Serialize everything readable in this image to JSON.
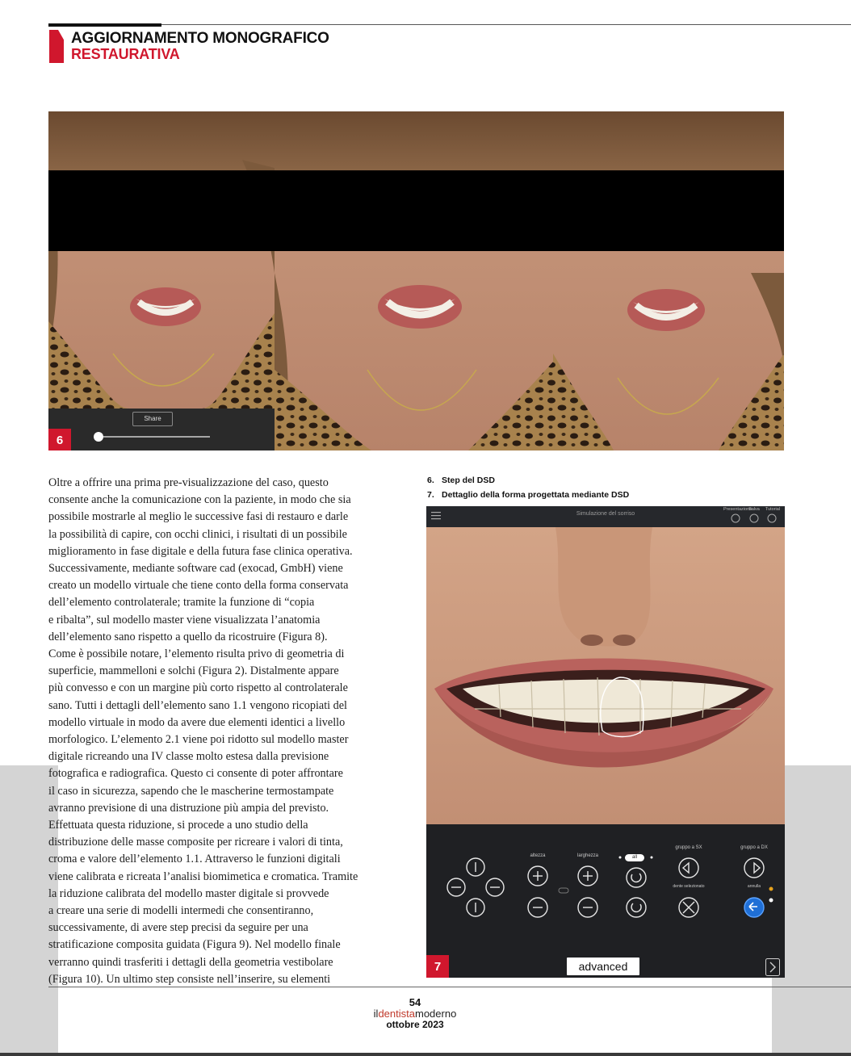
{
  "header": {
    "title": "AGGIORNAMENTO MONOGRAFICO",
    "subtitle": "RESTAURATIVA"
  },
  "figure6": {
    "number": "6",
    "share_label": "Share",
    "slider_value": 0.0
  },
  "body_lines": [
    "Oltre a offrire una prima pre-visualizzazione del caso, questo",
    "consente anche la comunicazione con la paziente, in modo che sia",
    "possibile mostrarle al meglio le successive fasi di restauro e darle",
    "la possibilità di capire, con occhi clinici, i risultati di un possibile",
    "miglioramento in fase digitale e della futura fase clinica operativa.",
    "Successivamente, mediante software cad (exocad, GmbH) viene",
    "creato un modello virtuale che tiene conto della forma conservata",
    "dell’elemento controlaterale; tramite la funzione di “copia",
    "e ribalta”, sul modello master viene visualizzata l’anatomia",
    "dell’elemento sano rispetto a quello da ricostruire (Figura 8).",
    "Come è possibile notare, l’elemento risulta privo di geometria di",
    "superficie, mammelloni e solchi (Figura 2). Distalmente appare",
    "più convesso e con un margine più corto rispetto al controlaterale",
    "sano. Tutti i dettagli dell’elemento sano 1.1 vengono ricopiati del",
    "modello virtuale in modo da avere due elementi identici a livello",
    "morfologico. L’elemento 2.1 viene poi ridotto sul modello master",
    "digitale ricreando una IV classe molto estesa dalla previsione",
    "fotografica e radiografica. Questo ci consente di poter affrontare",
    "il caso in sicurezza, sapendo che le mascherine termostampate",
    "avranno previsione di una distruzione più ampia del previsto.",
    "Effettuata questa riduzione, si procede a uno studio della",
    "distribuzione delle masse composite per ricreare i valori di tinta,",
    "croma e valore dell’elemento 1.1. Attraverso le funzioni digitali",
    "viene calibrata e ricreata l’analisi biomimetica e cromatica. Tramite",
    "la riduzione calibrata del modello master digitale si provvede",
    "a creare una serie di modelli intermedi che consentiranno,",
    "successivamente, di avere step precisi da seguire per una",
    "stratificazione composita guidata (Figura 9). Nel modello finale",
    "verranno quindi trasferiti i dettagli della geometria vestibolare",
    "(Figura 10). Un ultimo step consiste nell’inserire, su elementi"
  ],
  "captions": [
    {
      "num": "6.",
      "text": "Step del DSD"
    },
    {
      "num": "7.",
      "text": "Dettaglio della forma progettata mediante DSD"
    }
  ],
  "figure7": {
    "number": "7",
    "app_title": "Simulazione del sorriso",
    "top_icons": [
      "Presentazione",
      "Salva",
      "Tutorial"
    ],
    "labels": {
      "altezza": "altezza",
      "larghezza": "larghezza",
      "all": "all",
      "gruppo_sx": "gruppo a SX",
      "gruppo_dx": "gruppo a DX",
      "dente_selezionato": "dente selezionato",
      "annulla": "annulla"
    },
    "advanced_label": "advanced"
  },
  "footer": {
    "page": "54",
    "mag_il": "il",
    "mag_dentista": "dentista",
    "mag_moderno": "moderno",
    "issue": "ottobre 2023"
  },
  "colors": {
    "accent": "#d0172d",
    "app_bg": "#1f2023",
    "page_band": "#d4d4d4"
  }
}
